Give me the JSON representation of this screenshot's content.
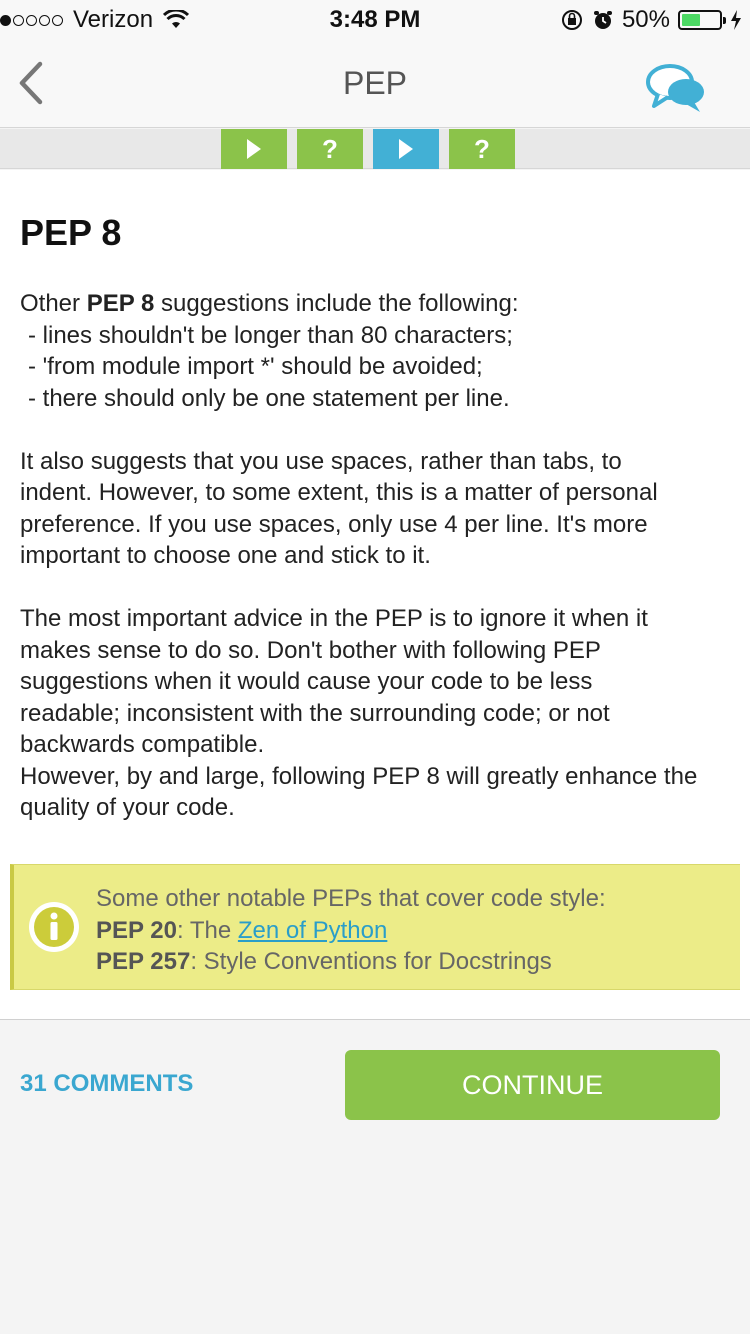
{
  "status_bar": {
    "carrier": "Verizon",
    "time": "3:48 PM",
    "battery": "50%",
    "battery_level": 0.5
  },
  "nav": {
    "title": "PEP",
    "back_icon": "chevron-left-icon",
    "comments_icon": "speech-bubbles-icon"
  },
  "progress": {
    "steps": [
      {
        "type": "play",
        "label": "",
        "state": "done",
        "color": "#8bc34a"
      },
      {
        "type": "quiz",
        "label": "?",
        "state": "done",
        "color": "#8bc34a"
      },
      {
        "type": "play",
        "label": "",
        "state": "current",
        "color": "#42b0d5"
      },
      {
        "type": "quiz",
        "label": "?",
        "state": "done",
        "color": "#8bc34a"
      }
    ]
  },
  "lesson": {
    "title": "PEP 8",
    "intro_pre": "Other ",
    "intro_bold": "PEP 8",
    "intro_post": " suggestions include the following:",
    "bullets": [
      "- lines shouldn't be longer than 80 characters;",
      "- 'from module import *' should be avoided;",
      "- there should only be one statement per line."
    ],
    "para2_lines": [
      "It also suggests that you use spaces, rather than tabs, to",
      "indent. However, to some extent, this is a matter of personal",
      "preference. If you use spaces, only use 4 per line. It's more",
      "important to choose one and stick to it."
    ],
    "para3_lines": [
      "The most important advice in the PEP is to ignore it when it",
      "makes sense to do so. Don't bother with following PEP",
      "suggestions when it would cause your code to be less",
      "readable; inconsistent with the surrounding code; or not",
      "backwards compatible.",
      "However, by and large, following PEP 8 will greatly enhance the",
      "quality of your code."
    ]
  },
  "note": {
    "icon": "info-icon",
    "heading": "Some other notable PEPs that cover code style:",
    "pep20_bold": "PEP 20",
    "pep20_mid": ": The ",
    "pep20_link": "Zen of Python",
    "pep257_bold": "PEP 257",
    "pep257_rest": ": Style Conventions for Docstrings"
  },
  "footer": {
    "comments_label": "31 COMMENTS",
    "continue_label": "CONTINUE"
  },
  "colors": {
    "accent_green": "#8bc34a",
    "accent_blue": "#42b0d5",
    "note_yellow": "#ecec88"
  }
}
